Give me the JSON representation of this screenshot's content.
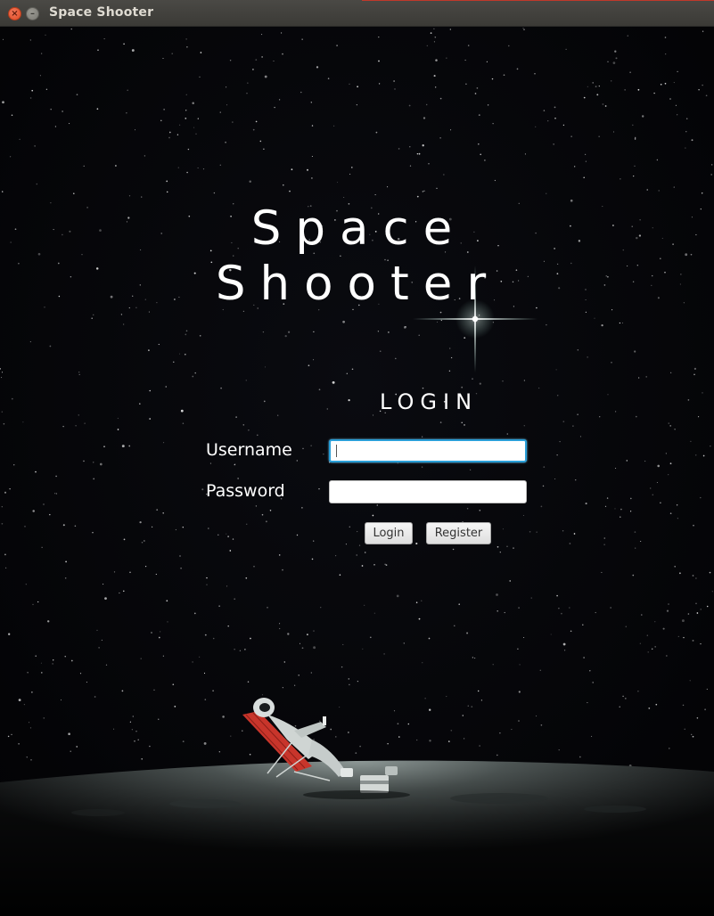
{
  "window": {
    "title": "Space Shooter",
    "close_glyph": "×",
    "minimize_glyph": "–"
  },
  "game": {
    "title_line1": "Space",
    "title_line2": "Shooter"
  },
  "login": {
    "heading": "LOGIN",
    "username_label": "Username",
    "password_label": "Password",
    "username_value": "",
    "password_value": "",
    "login_button": "Login",
    "register_button": "Register"
  },
  "colors": {
    "background": "#040407",
    "text": "#ffffff",
    "focus_ring": "#2a9fd8",
    "close_button": "#de4b24"
  },
  "icons": {
    "close": "close-icon",
    "minimize": "minimize-icon"
  }
}
